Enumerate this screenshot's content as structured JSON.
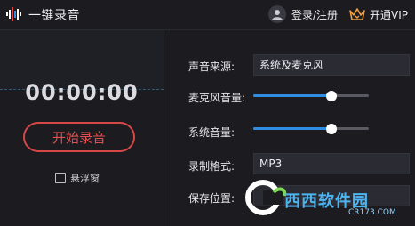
{
  "titlebar": {
    "app_title": "一键录音",
    "login_label": "登录/注册",
    "vip_label": "开通VIP"
  },
  "left": {
    "timer": "00:00:00",
    "start_label": "开始录音",
    "float_window_label": "悬浮窗",
    "float_window_checked": false
  },
  "settings": {
    "source_label": "声音来源:",
    "source_value": "系统及麦克风",
    "mic_volume_label": "麦克风音量:",
    "mic_volume_fraction": 0.68,
    "system_volume_label": "系统音量:",
    "system_volume_fraction": 0.68,
    "format_label": "录制格式:",
    "format_value": "MP3",
    "save_location_label": "保存位置:"
  },
  "watermark": {
    "text": "西西软件园",
    "domain": "CR173.COM"
  },
  "colors": {
    "background": "#1b1b20",
    "accent_blue": "#2f8de4",
    "record_red": "#d64848",
    "vip_orange": "#f0a040"
  }
}
